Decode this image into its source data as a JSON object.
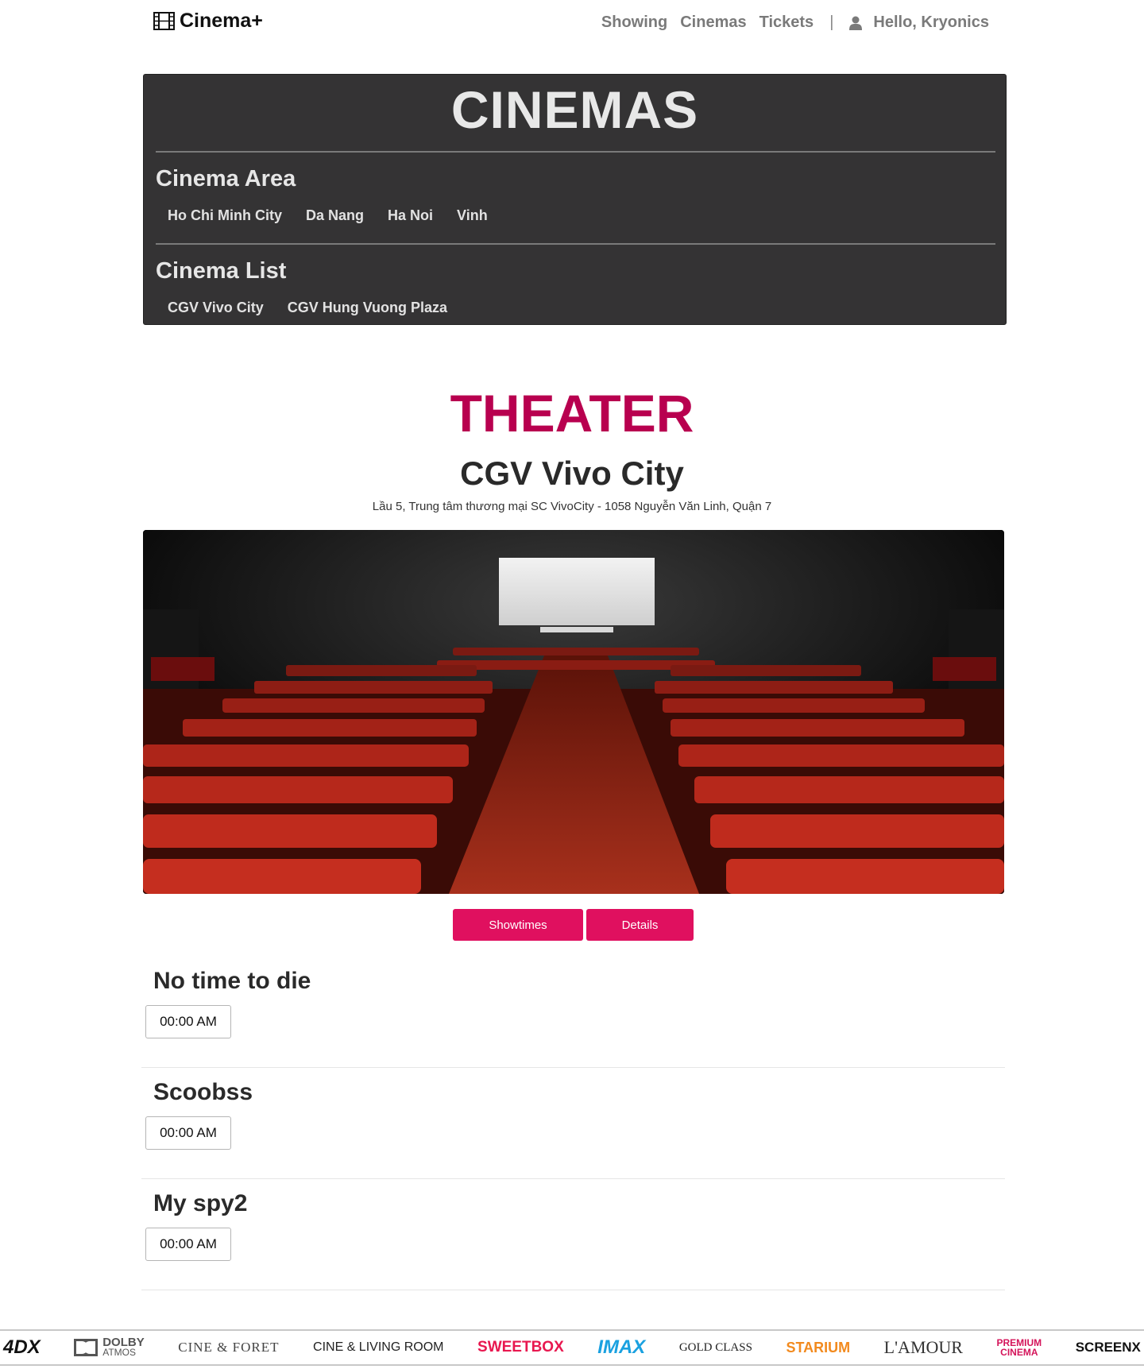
{
  "nav": {
    "brand": "Cinema+",
    "links": [
      "Showing",
      "Cinemas",
      "Tickets"
    ],
    "separator": "|",
    "greeting": "Hello, Kryonics"
  },
  "cinemas_panel": {
    "title": "CINEMAS",
    "area_heading": "Cinema Area",
    "areas": [
      "Ho Chi Minh City",
      "Da Nang",
      "Ha Noi",
      "Vinh"
    ],
    "list_heading": "Cinema List",
    "cinemas": [
      "CGV Vivo City",
      "CGV Hung Vuong Plaza"
    ]
  },
  "theater": {
    "title": "THEATER",
    "name": "CGV Vivo City",
    "address": "Lầu 5, Trung tâm thương mại SC VivoCity - 1058 Nguyễn Văn Linh, Quận 7",
    "tabs": [
      "Showtimes",
      "Details"
    ]
  },
  "showtimes": [
    {
      "title": "No time to die",
      "times": [
        "00:00 AM"
      ]
    },
    {
      "title": "Scoobss",
      "times": [
        "00:00 AM"
      ]
    },
    {
      "title": "My spy2",
      "times": [
        "00:00 AM"
      ]
    }
  ],
  "footer_brands": {
    "b4dx": "4DX",
    "dolby_top": "DOLBY",
    "dolby_bottom": "ATMOS",
    "cineforet": "CINE & FORET",
    "cineliving": "CINE & LIVING ROOM",
    "sweetbox": "SWEETBOX",
    "imax": "IMAX",
    "goldclass": "GOLD CLASS",
    "starium": "STARIUM",
    "lamour": "L'AMOUR",
    "premium_top": "PREMIUM",
    "premium_bottom": "CINEMA",
    "screenx": "SCREENX"
  },
  "colors": {
    "accent": "#e0105f",
    "theater_title": "#b8004f",
    "panel_bg": "#343334"
  }
}
